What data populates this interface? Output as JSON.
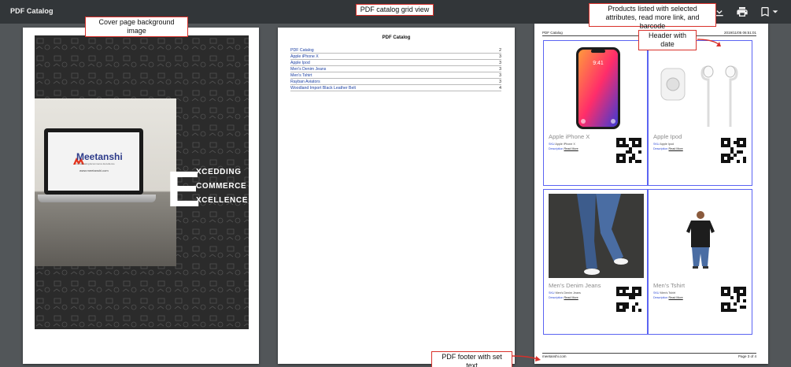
{
  "toolbar": {
    "title": "PDF Catalog"
  },
  "icons": {
    "download": "download-icon",
    "print": "print-icon",
    "bookmark": "bookmark-icon",
    "dropdown": "chevron-down-icon"
  },
  "cover": {
    "brand_name": "Meetanshi",
    "brand_tagline": "Accelerating Ecommerce Excellence",
    "brand_url": "www.meetanshi.com",
    "big_letter": "E",
    "lines": [
      "XCEDDING",
      "COMMERCE",
      "XCELLENCE"
    ]
  },
  "toc": {
    "title": "PDF Catalog",
    "items": [
      {
        "label": "PDF Catalog",
        "page": "2"
      },
      {
        "label": "Apple iPhone X",
        "page": "3"
      },
      {
        "label": "Apple Ipod",
        "page": "3"
      },
      {
        "label": "Men's Denim Jeans",
        "page": "3"
      },
      {
        "label": "Men's Tshirt",
        "page": "3"
      },
      {
        "label": "Rayban Aviators",
        "page": "3"
      },
      {
        "label": "Woodland Import Black Leather Belt",
        "page": "4"
      }
    ]
  },
  "grid_page": {
    "header_left": "PDF Catalog",
    "header_right": "2019/11/05 06:51:01",
    "footer_left": "meetanshi.com",
    "footer_right": "Page 3 of 4",
    "sku_label": "SKU",
    "desc_label": "Description",
    "read_more": "Read More",
    "products": [
      {
        "name": "Apple iPhone X",
        "sku": "Apple iPhone X"
      },
      {
        "name": "Apple Ipod",
        "sku": "Apple Ipod"
      },
      {
        "name": "Men's Denim Jeans",
        "sku": "Men's Denim Jeans"
      },
      {
        "name": "Men's Tshirt",
        "sku": "Men's Tshirt"
      }
    ],
    "phone_time": "9:41"
  },
  "callouts": {
    "cover_bg": "Cover page background image",
    "grid_view": "PDF catalog grid view",
    "products_listed_1": "Products listed with selected",
    "products_listed_2": "attributes, read more link, and barcode",
    "header_date": "Header with date",
    "footer_text": "PDF footer with set text"
  },
  "colors": {
    "toolbar": "#323639",
    "background": "#525659",
    "callout_border": "#d9302a",
    "grid_border": "#5b64f2",
    "link": "#2e4bd6"
  }
}
